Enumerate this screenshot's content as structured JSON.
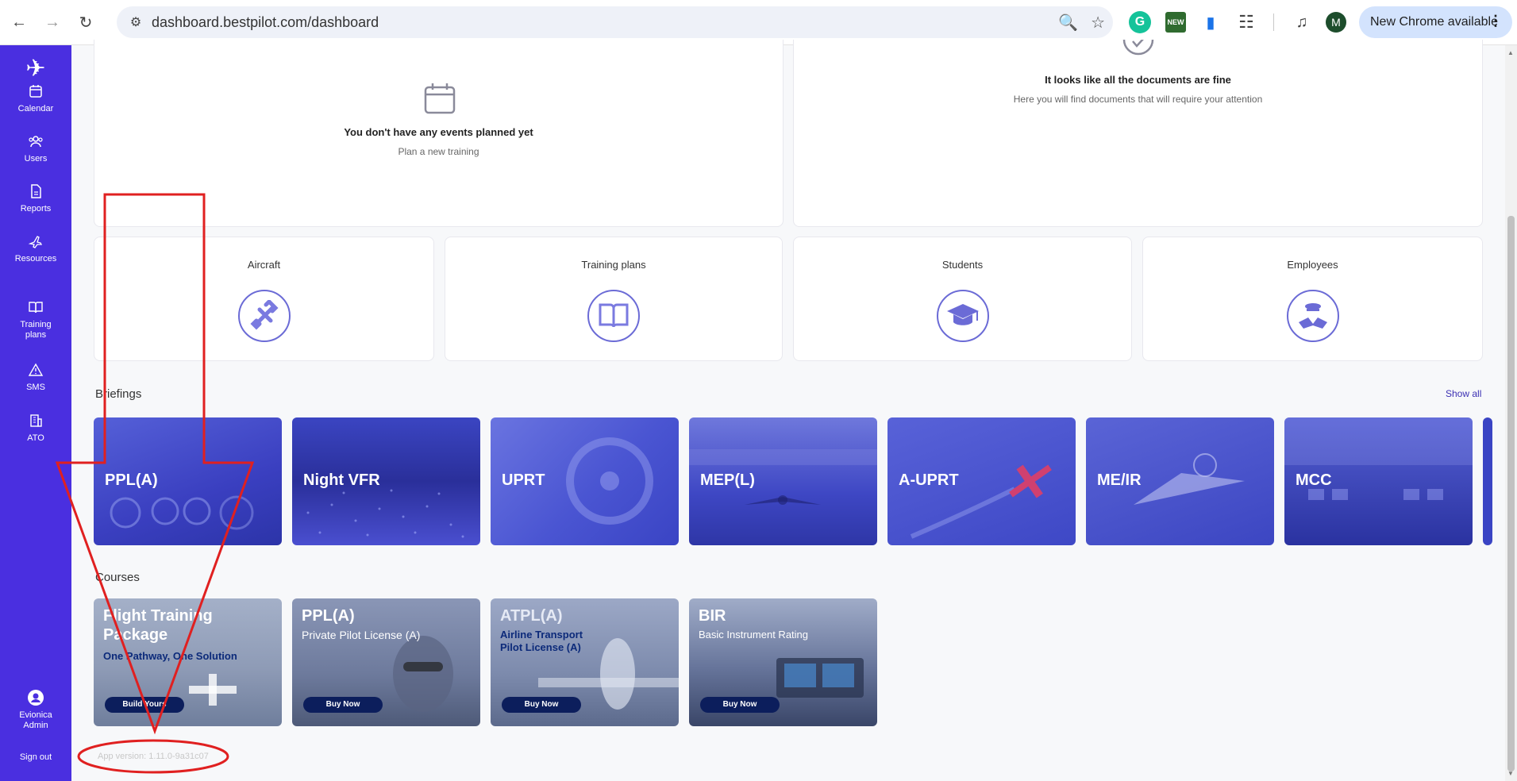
{
  "browser": {
    "url": "dashboard.bestpilot.com/dashboard",
    "profile_initial": "M",
    "update_label": "New Chrome available",
    "ext_new_label": "NEW"
  },
  "sidebar": {
    "items": [
      {
        "label": "Calendar"
      },
      {
        "label": "Users"
      },
      {
        "label": "Reports"
      },
      {
        "label": "Resources"
      },
      {
        "label": "Training plans"
      },
      {
        "label": "SMS"
      },
      {
        "label": "ATO"
      }
    ],
    "user_name": "Evionica Admin",
    "sign_out": "Sign out"
  },
  "events_card": {
    "title": "You don't have any events planned yet",
    "subtitle": "Plan a new training"
  },
  "documents_card": {
    "title": "It looks like all the documents are fine",
    "subtitle": "Here you will find documents that will require your attention"
  },
  "tiles": [
    {
      "title": "Aircraft",
      "icon": "airplane-icon"
    },
    {
      "title": "Training plans",
      "icon": "book-icon"
    },
    {
      "title": "Students",
      "icon": "graduation-cap-icon"
    },
    {
      "title": "Employees",
      "icon": "pilot-badge-icon"
    }
  ],
  "briefings": {
    "label": "Briefings",
    "show_all": "Show all",
    "items": [
      {
        "label": "PPL(A)"
      },
      {
        "label": "Night VFR"
      },
      {
        "label": "UPRT"
      },
      {
        "label": "MEP(L)"
      },
      {
        "label": "A-UPRT"
      },
      {
        "label": "ME/IR"
      },
      {
        "label": "MCC"
      }
    ]
  },
  "courses": {
    "label": "Courses",
    "items": [
      {
        "title_1": "Flight Training",
        "title_2": "Package",
        "subtitle_1": "One Pathway, One Solution",
        "subtitle_2": "",
        "button": "Build Yours"
      },
      {
        "title_1": "PPL(A)",
        "title_2": "",
        "subtitle_1": "Private Pilot License (A)",
        "subtitle_2": "",
        "button": "Buy Now"
      },
      {
        "title_1": "ATPL(A)",
        "title_2": "",
        "subtitle_1": "Airline Transport",
        "subtitle_2": "Pilot License (A)",
        "button": "Buy Now"
      },
      {
        "title_1": "BIR",
        "title_2": "",
        "subtitle_1": "Basic Instrument Rating",
        "subtitle_2": "",
        "button": "Buy Now"
      }
    ]
  },
  "app_version": "App version: 1.11.0-9a31c07",
  "colors": {
    "sidebar": "#4a2fe0",
    "accent": "#3b2fb3",
    "annotation": "#e02020"
  }
}
